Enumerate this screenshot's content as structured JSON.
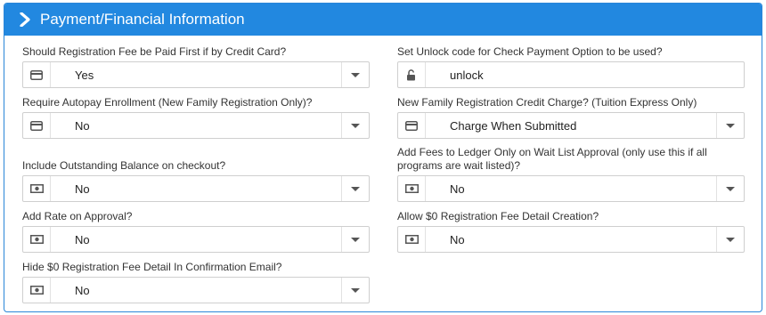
{
  "panel": {
    "title": "Payment/Financial Information"
  },
  "fields": {
    "reg_fee_first": {
      "label": "Should Registration Fee be Paid First if by Credit Card?",
      "value": "Yes",
      "icon": "credit-card-icon"
    },
    "unlock_code": {
      "label": "Set Unlock code for Check Payment Option to be used?",
      "value": "unlock",
      "icon": "unlock-icon"
    },
    "autopay": {
      "label": "Require Autopay Enrollment (New Family Registration Only)?",
      "value": "No",
      "icon": "credit-card-icon"
    },
    "credit_charge": {
      "label": "New Family Registration Credit Charge? (Tuition Express Only)",
      "value": "Charge When Submitted",
      "icon": "credit-card-icon"
    },
    "outstanding_balance": {
      "label": "Include Outstanding Balance on checkout?",
      "value": "No",
      "icon": "money-icon"
    },
    "ledger_wait_list": {
      "label": "Add Fees to Ledger Only on Wait List Approval (only use this if all programs are wait listed)?",
      "value": "No",
      "icon": "money-icon"
    },
    "rate_on_approval": {
      "label": "Add Rate on Approval?",
      "value": "No",
      "icon": "money-icon"
    },
    "zero_fee_detail": {
      "label": "Allow $0 Registration Fee Detail Creation?",
      "value": "No",
      "icon": "money-icon"
    },
    "hide_zero_fee": {
      "label": "Hide $0 Registration Fee Detail In Confirmation Email?",
      "value": "No",
      "icon": "money-icon"
    }
  },
  "colors": {
    "header_bg": "#2288e0",
    "border": "#2a86d8"
  }
}
